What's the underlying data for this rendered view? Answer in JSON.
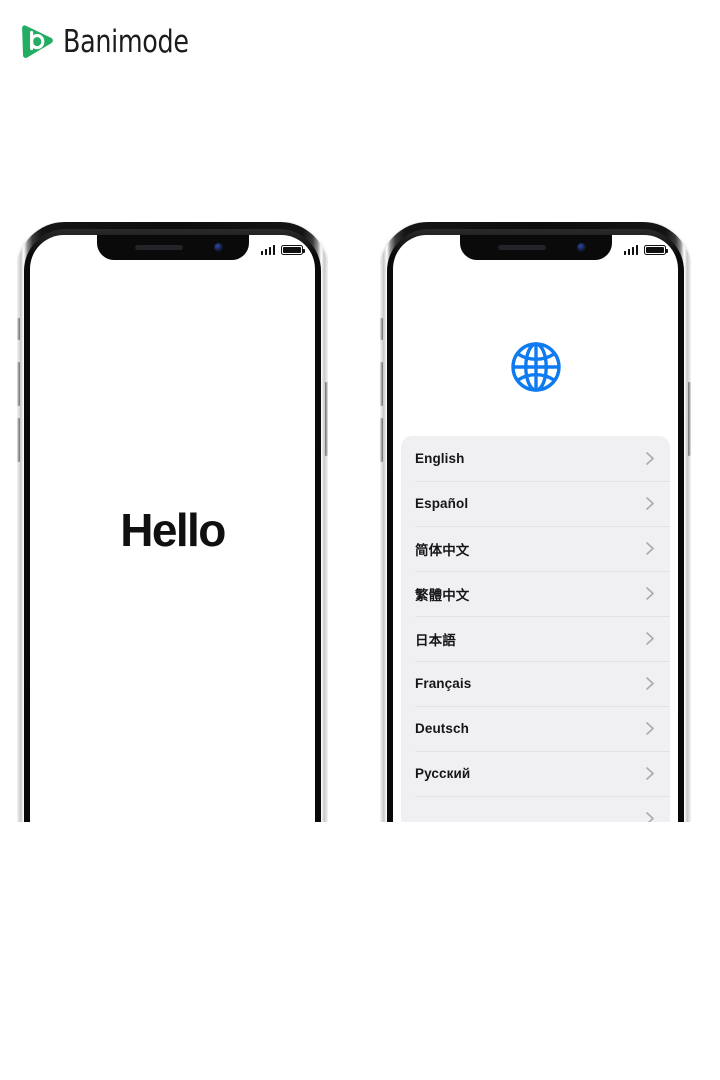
{
  "brand": {
    "name": "Banimode",
    "logo_icon": "banimode-play-b-logo",
    "logo_color": "#22ad63",
    "text_color": "#1c1c1c"
  },
  "phones": [
    {
      "id": "phone-hello",
      "status_bar": {
        "signal_icon": "cellular-signal-icon",
        "signal_bars": 4,
        "battery_icon": "battery-full-icon"
      },
      "hardware": {
        "notch_speaker": "earpiece-speaker",
        "notch_camera": "front-camera",
        "mute_switch": "mute-switch-button",
        "volume_up": "volume-up-button",
        "volume_down": "volume-down-button",
        "power": "power-button"
      },
      "screen": {
        "greeting": "Hello"
      }
    },
    {
      "id": "phone-language",
      "status_bar": {
        "signal_icon": "cellular-signal-icon",
        "signal_bars": 4,
        "battery_icon": "battery-full-icon"
      },
      "hardware": {
        "notch_speaker": "earpiece-speaker",
        "notch_camera": "front-camera",
        "mute_switch": "mute-switch-button",
        "volume_up": "volume-up-button",
        "volume_down": "volume-down-button",
        "power": "power-button"
      },
      "screen": {
        "header_icon": "globe-icon",
        "header_icon_color": "#0f7bf0",
        "list_background": "#f0f0f3",
        "chevron_icon": "chevron-right-icon",
        "languages": [
          {
            "label": "English"
          },
          {
            "label": "Español"
          },
          {
            "label": "简体中文"
          },
          {
            "label": "繁體中文"
          },
          {
            "label": "日本語"
          },
          {
            "label": "Français"
          },
          {
            "label": "Deutsch"
          },
          {
            "label": "Русский"
          },
          {
            "label": ""
          }
        ]
      }
    }
  ]
}
